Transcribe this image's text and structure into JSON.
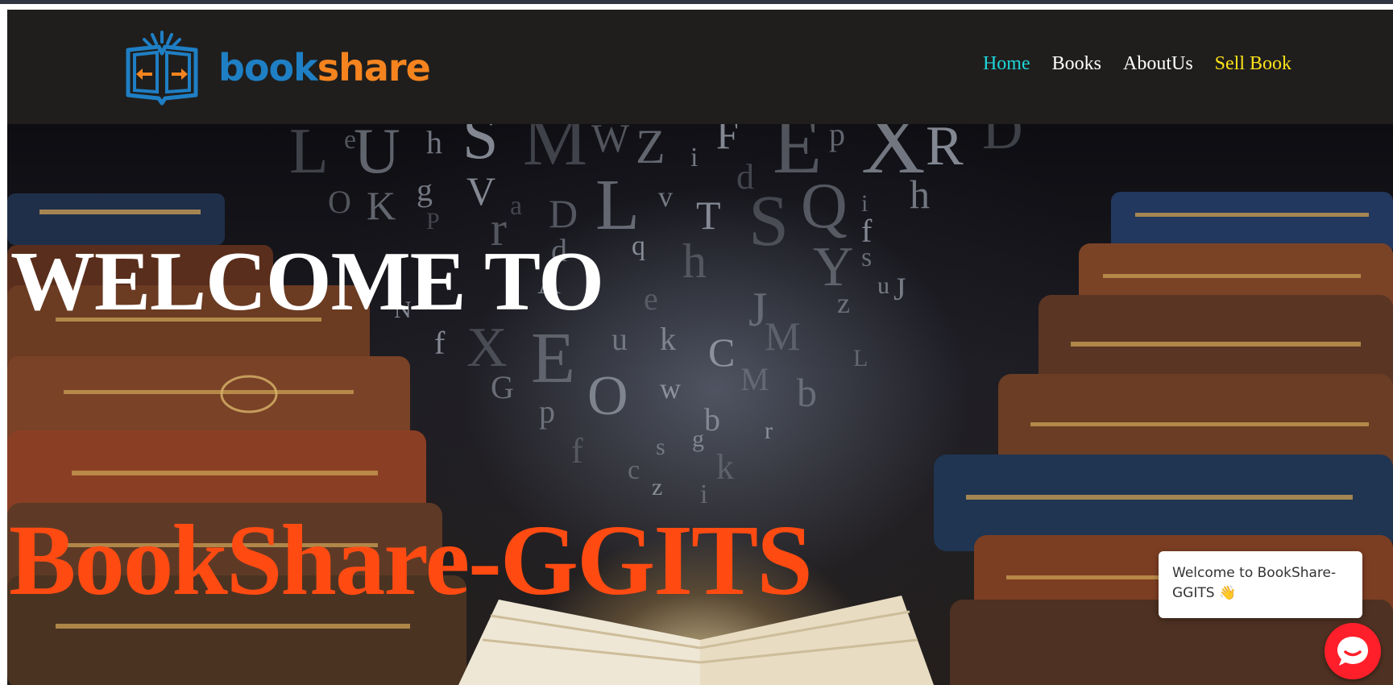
{
  "header": {
    "logo": {
      "part1": "book",
      "part2": "share",
      "color1": "#1f7fc4",
      "color2": "#f5841f",
      "icon": "open-book-icon"
    },
    "nav": [
      {
        "label": "Home",
        "color": "#1fd5d9"
      },
      {
        "label": "Books",
        "color": "#ffffff"
      },
      {
        "label": "AboutUs",
        "color": "#ffffff"
      },
      {
        "label": "Sell Book",
        "color": "#ffe21a"
      }
    ]
  },
  "hero": {
    "welcome": "WELCOME TO",
    "brand": "BookShare-GGITS",
    "brand_color": "#ff4b12",
    "background": "library-books-flying-letters",
    "letters": [
      "L",
      "e",
      "U",
      "h",
      "S",
      "M",
      "W",
      "Z",
      "i",
      "F",
      "d",
      "E",
      "p",
      "X",
      "R",
      "D",
      "O",
      "K",
      "g",
      "V",
      "a",
      "D",
      "L",
      "v",
      "T",
      "S",
      "Q",
      "i",
      "h",
      "f",
      "P",
      "r",
      "d",
      "A",
      "q",
      "h",
      "Y",
      "s",
      "J",
      "N",
      "e",
      "J",
      "z",
      "u",
      "f",
      "X",
      "E",
      "u",
      "k",
      "C",
      "M",
      "L",
      "G",
      "O",
      "w",
      "M",
      "b",
      "p",
      "b",
      "r",
      "f",
      "c",
      "s",
      "g",
      "z",
      "k",
      "i"
    ]
  },
  "chat": {
    "message": "Welcome to BookShare-GGITS 👋",
    "button_icon": "chat-icon",
    "color": "#ff1f2a"
  }
}
